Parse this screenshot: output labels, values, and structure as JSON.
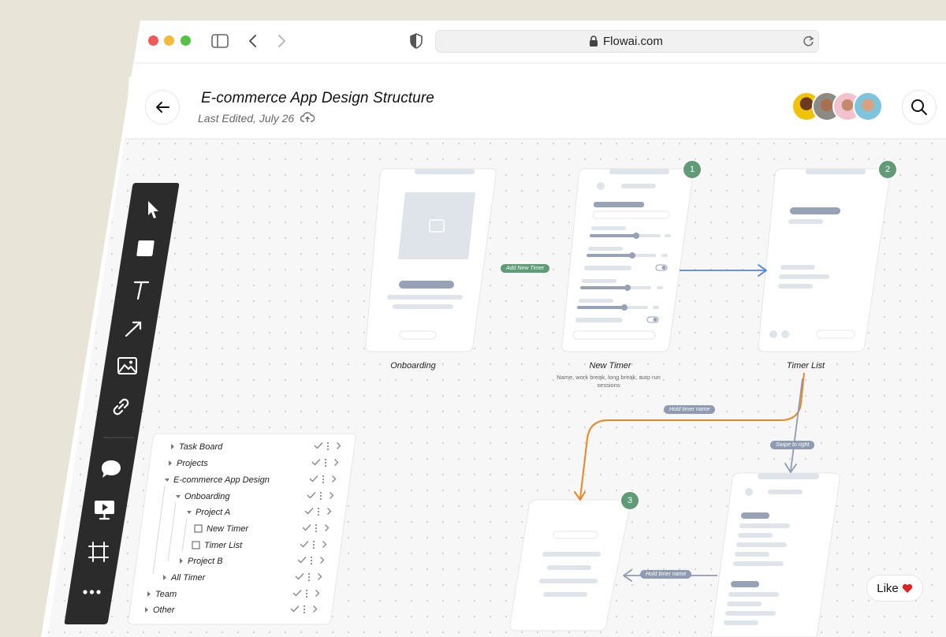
{
  "browser": {
    "url": "Flowai.com"
  },
  "header": {
    "title": "E-commerce App Design Structure",
    "subtitle": "Last Edited, July 26"
  },
  "avatars": [
    "avatar-1",
    "avatar-2",
    "avatar-3",
    "avatar-4"
  ],
  "tools": [
    "pointer-icon",
    "rectangle-icon",
    "text-icon",
    "arrow-icon",
    "image-icon",
    "link-icon",
    "comment-icon",
    "present-icon",
    "frame-icon",
    "more-icon"
  ],
  "screens": {
    "onboarding": {
      "label": "Onboarding"
    },
    "new_timer": {
      "label": "New Timer",
      "description": "Name, work break, long break, auto run sessions",
      "badge": "1"
    },
    "timer_list": {
      "label": "Timer List",
      "badge": "2"
    },
    "screen3": {
      "badge": "3"
    }
  },
  "connectors": {
    "add_new_timer": "Add New Timer",
    "hold_timer_name_1": "Hold timer name",
    "swipe_to_right": "Swipe to right",
    "hold_timer_name_2": "Hold timer name"
  },
  "tree": [
    {
      "label": "Task Board"
    },
    {
      "label": "Projects"
    },
    {
      "label": "E-commerce App Design"
    },
    {
      "label": "Onboarding"
    },
    {
      "label": "Project A"
    },
    {
      "label": "New Timer"
    },
    {
      "label": "Timer List"
    },
    {
      "label": "Project B"
    },
    {
      "label": "All Timer"
    },
    {
      "label": "Team"
    },
    {
      "label": "Other"
    }
  ],
  "like": {
    "label": "Like"
  },
  "colors": {
    "accent_green": "#5f9b77",
    "arrow_blue": "#4f86d6",
    "arrow_orange": "#e98624",
    "arrow_gray": "#8e9bb0",
    "like_heart": "#e0211f"
  }
}
